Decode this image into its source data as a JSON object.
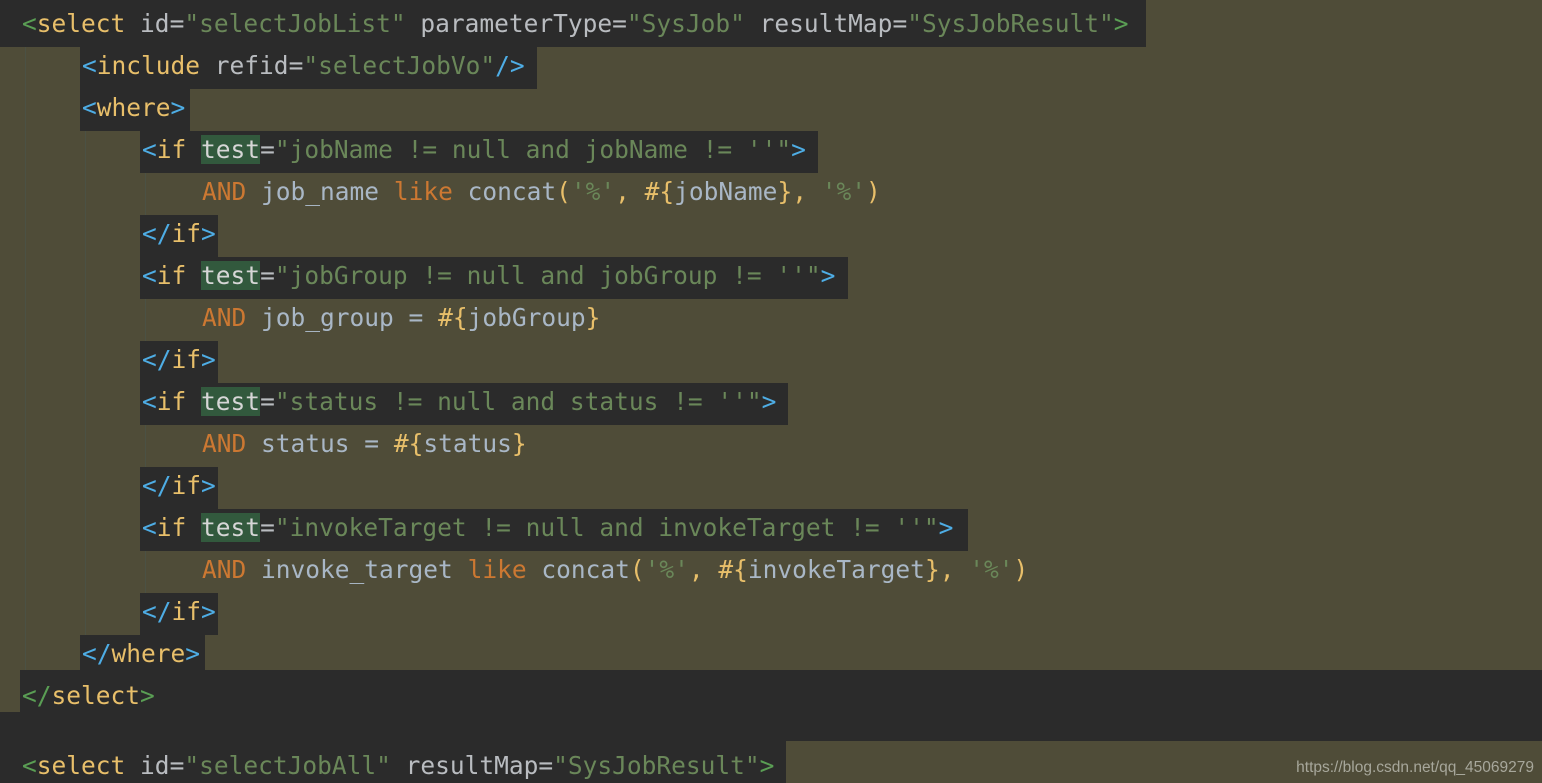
{
  "editor": {
    "language": "xml-mybatis",
    "theme": "darcula",
    "background_code": "#2b2b2b",
    "background_highlight": "#4f4c38",
    "search_match_highlight": "#32593d",
    "indent_guide_color": "#4b5144"
  },
  "colors": {
    "tag_bracket_blue": "#4eade5",
    "tag_bracket_green": "#5a9e54",
    "tag_name": "#e8bf6a",
    "attribute": "#b9bcc0",
    "string": "#6a8759",
    "keyword": "#cc7832",
    "identifier": "#a9b7c6",
    "brace": "#e8bf6a"
  },
  "code": {
    "lines": [
      {
        "n": 1,
        "indent": 0,
        "text": "<select id=\"selectJobList\" parameterType=\"SysJob\" resultMap=\"SysJobResult\">"
      },
      {
        "n": 2,
        "indent": 1,
        "text": "<include refid=\"selectJobVo\"/>"
      },
      {
        "n": 3,
        "indent": 1,
        "text": "<where>"
      },
      {
        "n": 4,
        "indent": 2,
        "text": "<if test=\"jobName != null and jobName != ''\">"
      },
      {
        "n": 5,
        "indent": 3,
        "text": "AND job_name like concat('%', #{jobName}, '%')"
      },
      {
        "n": 6,
        "indent": 2,
        "text": "</if>"
      },
      {
        "n": 7,
        "indent": 2,
        "text": "<if test=\"jobGroup != null and jobGroup != ''\">"
      },
      {
        "n": 8,
        "indent": 3,
        "text": "AND job_group = #{jobGroup}"
      },
      {
        "n": 9,
        "indent": 2,
        "text": "</if>"
      },
      {
        "n": 10,
        "indent": 2,
        "text": "<if test=\"status != null and status != ''\">"
      },
      {
        "n": 11,
        "indent": 3,
        "text": "AND status = #{status}"
      },
      {
        "n": 12,
        "indent": 2,
        "text": "</if>"
      },
      {
        "n": 13,
        "indent": 2,
        "text": "<if test=\"invokeTarget != null and invokeTarget != ''\">"
      },
      {
        "n": 14,
        "indent": 3,
        "text": "AND invoke_target like concat('%', #{invokeTarget}, '%')"
      },
      {
        "n": 15,
        "indent": 2,
        "text": "</if>"
      },
      {
        "n": 16,
        "indent": 1,
        "text": "</where>"
      },
      {
        "n": 17,
        "indent": 0,
        "text": "</select>"
      },
      {
        "n": 18,
        "indent": 0,
        "text": ""
      },
      {
        "n": 19,
        "indent": 0,
        "text": "<select id=\"selectJobAll\" resultMap=\"SysJobResult\">"
      }
    ],
    "tokens": {
      "l1": {
        "b_open": "<",
        "tag": "select",
        "sp1": " ",
        "a1": "id",
        "eq1": "=",
        "v1": "\"selectJobList\"",
        "sp2": " ",
        "a2": "parameterType",
        "eq2": "=",
        "v2": "\"SysJob\"",
        "sp3": " ",
        "a3": "resultMap",
        "eq3": "=",
        "v3": "\"SysJobResult\"",
        "b_close": ">"
      },
      "l2": {
        "b_open": "<",
        "tag": "include",
        "sp1": " ",
        "a1": "refid",
        "eq1": "=",
        "v1": "\"selectJobVo\"",
        "b_close": "/>"
      },
      "l3": {
        "b_open": "<",
        "tag": "where",
        "b_close": ">"
      },
      "l16": {
        "b_open": "</",
        "tag": "where",
        "b_close": ">"
      },
      "l17": {
        "b_open": "</",
        "tag": "select",
        "b_close": ">"
      },
      "l19": {
        "b_open": "<",
        "tag": "select",
        "sp1": " ",
        "a1": "id",
        "eq1": "=",
        "v1": "\"selectJobAll\"",
        "sp2": " ",
        "a2": "resultMap",
        "eq2": "=",
        "v2": "\"SysJobResult\"",
        "b_close": ">"
      },
      "if_open": "<",
      "if_name": "if",
      "if_sp": " ",
      "if_test": "test",
      "if_eq": "=",
      "if_close": ">",
      "if_end_open": "</",
      "if_end_name": "if",
      "if_end_close": ">",
      "cond_jobName": "\"jobName != null and jobName != ''\"",
      "cond_jobGroup": "\"jobGroup != null and jobGroup != ''\"",
      "cond_status": "\"status != null and status != ''\"",
      "cond_invokeTarget": "\"invokeTarget != null and invokeTarget != ''\"",
      "kw_and": "AND",
      "kw_like": "like",
      "fn_concat": "concat",
      "paren_open": "(",
      "paren_close": ")",
      "comma_sp": ", ",
      "pct": "'%'",
      "brace_open": "#{",
      "brace_close": "}",
      "col_job_name": "job_name",
      "col_job_group": "job_group",
      "col_status": "status",
      "col_invoke_target": "invoke_target",
      "var_jobName": "jobName",
      "var_jobGroup": "jobGroup",
      "var_status": "status",
      "var_invokeTarget": "invokeTarget",
      "eq_sp": " = ",
      "sp": " "
    }
  },
  "watermark": {
    "text": "https://blog.csdn.net/qq_45069279"
  }
}
